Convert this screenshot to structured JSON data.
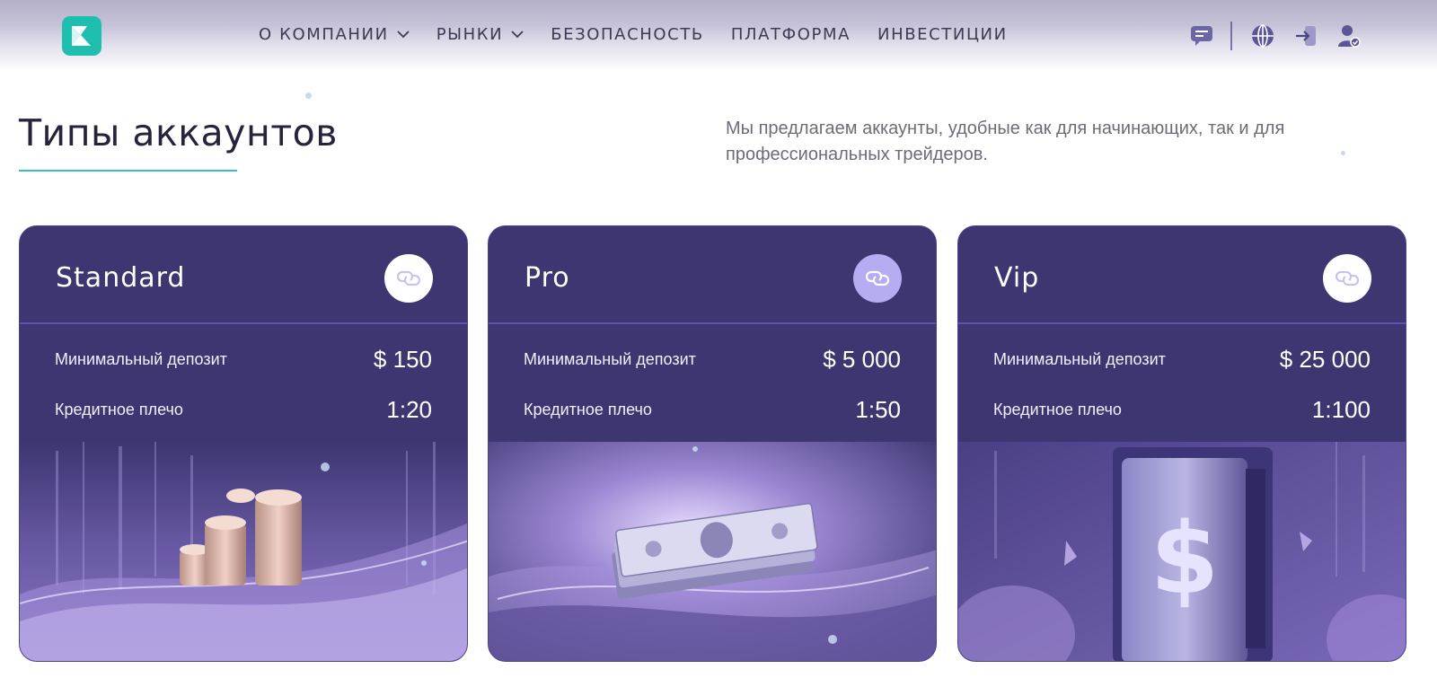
{
  "header": {
    "nav": [
      {
        "label": "О КОМПАНИИ",
        "dropdown": true
      },
      {
        "label": "РЫНКИ",
        "dropdown": true
      },
      {
        "label": "БЕЗОПАСНОСТЬ",
        "dropdown": false
      },
      {
        "label": "ПЛАТФОРМА",
        "dropdown": false
      },
      {
        "label": "ИНВЕСТИЦИИ",
        "dropdown": false
      }
    ],
    "icons": [
      "chat-icon",
      "globe-icon",
      "login-icon",
      "user-icon"
    ]
  },
  "section": {
    "title": "Типы аккаунтов",
    "description": "Мы предлагаем аккаунты, удобные как для начинающих, так и для профессиональных трейдеров."
  },
  "cards": [
    {
      "name": "Standard",
      "deposit_label": "Минимальный депозит",
      "deposit": "$ 150",
      "leverage_label": "Кредитное плечо",
      "leverage": "1:20",
      "image": "coins-illustration"
    },
    {
      "name": "Pro",
      "deposit_label": "Минимальный депозит",
      "deposit": "$ 5 000",
      "leverage_label": "Кредитное плечо",
      "leverage": "1:50",
      "image": "banknotes-illustration"
    },
    {
      "name": "Vip",
      "deposit_label": "Минимальный депозит",
      "deposit": "$ 25 000",
      "leverage_label": "Кредитное плечо",
      "leverage": "1:100",
      "image": "safe-illustration"
    }
  ],
  "colors": {
    "brand": "#1fbfb0",
    "card_bg": "#3d3671",
    "divider": "#5f51b6",
    "accent_button": "#b6acf2"
  }
}
